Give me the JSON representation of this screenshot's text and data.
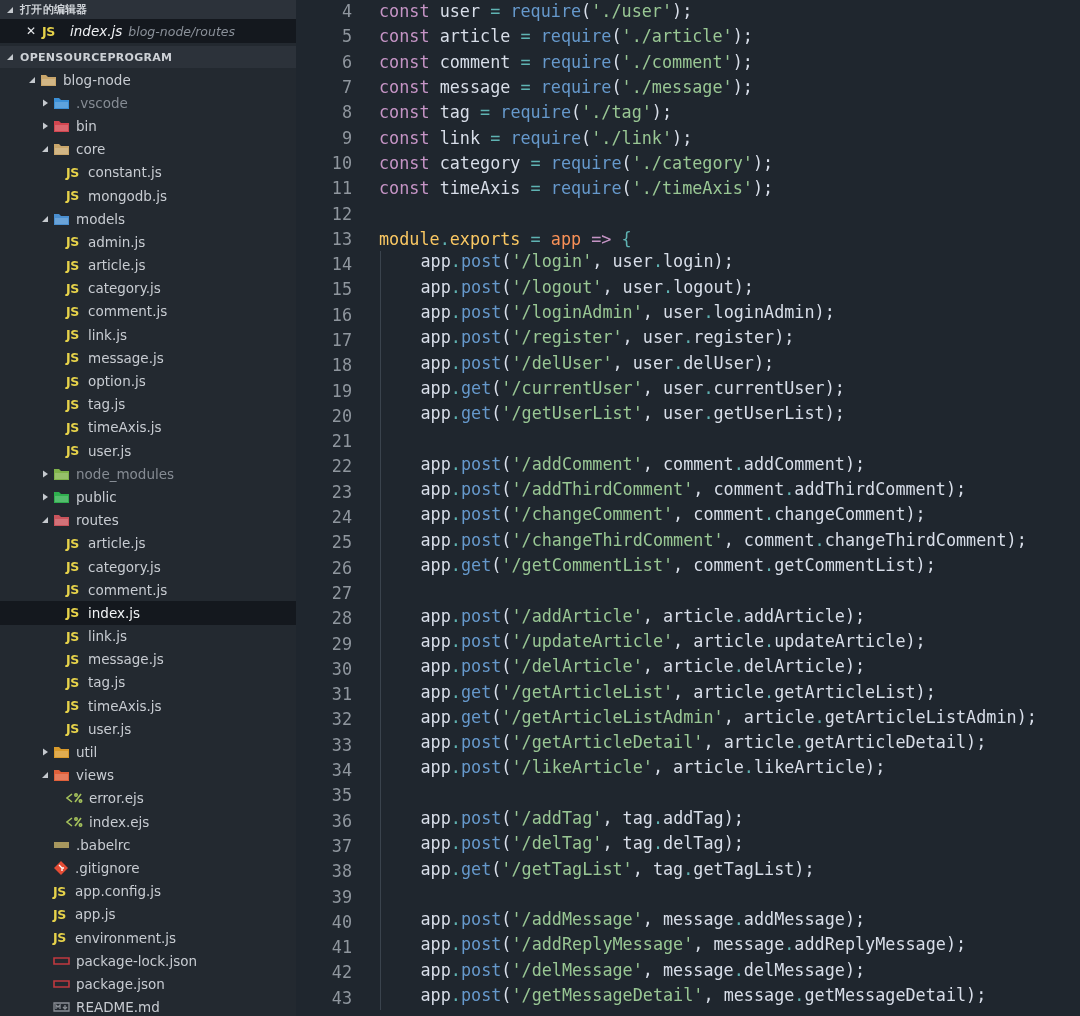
{
  "open_editors": {
    "title": "打开的编辑器",
    "expanded": true,
    "items": [
      {
        "close": "✕",
        "kind": "js",
        "icon": "JS",
        "name": "index.js",
        "path": "blog-node/routes",
        "selected": true
      }
    ]
  },
  "explorer": {
    "title": "OPENSOURCEPROGRAM",
    "expanded": true,
    "tree": [
      {
        "name": "blog-node",
        "kind": "folder",
        "color": "#c9a66b",
        "expanded": true,
        "selected": false,
        "ignored": false,
        "children": [
          {
            "name": ".vscode",
            "kind": "folder",
            "color": "#3b8fd6",
            "expanded": false,
            "selected": false,
            "ignored": true
          },
          {
            "name": "bin",
            "kind": "folder",
            "color": "#d2454f",
            "expanded": false,
            "selected": false,
            "ignored": false
          },
          {
            "name": "core",
            "kind": "folder",
            "color": "#c9a66b",
            "expanded": true,
            "selected": false,
            "ignored": false,
            "children": [
              {
                "name": "constant.js",
                "kind": "js",
                "icon": "JS",
                "selected": false,
                "ignored": false
              },
              {
                "name": "mongodb.js",
                "kind": "js",
                "icon": "JS",
                "selected": false,
                "ignored": false
              }
            ]
          },
          {
            "name": "models",
            "kind": "folder",
            "color": "#4a8fd0",
            "expanded": true,
            "selected": false,
            "ignored": false,
            "children": [
              {
                "name": "admin.js",
                "kind": "js",
                "icon": "JS",
                "selected": false,
                "ignored": false
              },
              {
                "name": "article.js",
                "kind": "js",
                "icon": "JS",
                "selected": false,
                "ignored": false
              },
              {
                "name": "category.js",
                "kind": "js",
                "icon": "JS",
                "selected": false,
                "ignored": false
              },
              {
                "name": "comment.js",
                "kind": "js",
                "icon": "JS",
                "selected": false,
                "ignored": false
              },
              {
                "name": "link.js",
                "kind": "js",
                "icon": "JS",
                "selected": false,
                "ignored": false
              },
              {
                "name": "message.js",
                "kind": "js",
                "icon": "JS",
                "selected": false,
                "ignored": false
              },
              {
                "name": "option.js",
                "kind": "js",
                "icon": "JS",
                "selected": false,
                "ignored": false
              },
              {
                "name": "tag.js",
                "kind": "js",
                "icon": "JS",
                "selected": false,
                "ignored": false
              },
              {
                "name": "timeAxis.js",
                "kind": "js",
                "icon": "JS",
                "selected": false,
                "ignored": false
              },
              {
                "name": "user.js",
                "kind": "js",
                "icon": "JS",
                "selected": false,
                "ignored": false
              }
            ]
          },
          {
            "name": "node_modules",
            "kind": "folder",
            "color": "#7fb24a",
            "expanded": false,
            "selected": false,
            "ignored": true
          },
          {
            "name": "public",
            "kind": "folder",
            "color": "#2fae4e",
            "expanded": false,
            "selected": false,
            "ignored": false
          },
          {
            "name": "routes",
            "kind": "folder",
            "color": "#c9545c",
            "expanded": true,
            "selected": false,
            "ignored": false,
            "children": [
              {
                "name": "article.js",
                "kind": "js",
                "icon": "JS",
                "selected": false,
                "ignored": false
              },
              {
                "name": "category.js",
                "kind": "js",
                "icon": "JS",
                "selected": false,
                "ignored": false
              },
              {
                "name": "comment.js",
                "kind": "js",
                "icon": "JS",
                "selected": false,
                "ignored": false
              },
              {
                "name": "index.js",
                "kind": "js",
                "icon": "JS",
                "selected": true,
                "ignored": false
              },
              {
                "name": "link.js",
                "kind": "js",
                "icon": "JS",
                "selected": false,
                "ignored": false
              },
              {
                "name": "message.js",
                "kind": "js",
                "icon": "JS",
                "selected": false,
                "ignored": false
              },
              {
                "name": "tag.js",
                "kind": "js",
                "icon": "JS",
                "selected": false,
                "ignored": false
              },
              {
                "name": "timeAxis.js",
                "kind": "js",
                "icon": "JS",
                "selected": false,
                "ignored": false
              },
              {
                "name": "user.js",
                "kind": "js",
                "icon": "JS",
                "selected": false,
                "ignored": false
              }
            ]
          },
          {
            "name": "util",
            "kind": "folder",
            "color": "#d99a2b",
            "expanded": false,
            "selected": false,
            "ignored": false
          },
          {
            "name": "views",
            "kind": "folder",
            "color": "#e0603a",
            "expanded": true,
            "selected": false,
            "ignored": false,
            "children": [
              {
                "name": "error.ejs",
                "kind": "ejs",
                "selected": false,
                "ignored": false
              },
              {
                "name": "index.ejs",
                "kind": "ejs",
                "selected": false,
                "ignored": false
              }
            ]
          },
          {
            "name": ".babelrc",
            "kind": "babel",
            "selected": false,
            "ignored": false
          },
          {
            "name": ".gitignore",
            "kind": "git",
            "selected": false,
            "ignored": false
          },
          {
            "name": "app.config.js",
            "kind": "js",
            "icon": "JS",
            "selected": false,
            "ignored": false
          },
          {
            "name": "app.js",
            "kind": "js",
            "icon": "JS",
            "selected": false,
            "ignored": false
          },
          {
            "name": "environment.js",
            "kind": "js",
            "icon": "JS",
            "selected": false,
            "ignored": false
          },
          {
            "name": "package-lock.json",
            "kind": "json",
            "selected": false,
            "ignored": false
          },
          {
            "name": "package.json",
            "kind": "json",
            "selected": false,
            "ignored": false
          },
          {
            "name": "README.md",
            "kind": "markdown",
            "selected": false,
            "ignored": false
          }
        ]
      }
    ]
  },
  "editor": {
    "lines": [
      {
        "number": "4",
        "indented": false,
        "tokens": [
          {
            "text": "const",
            "kind": "keyword"
          },
          {
            "text": " user ",
            "kind": "plain"
          },
          {
            "text": "= ",
            "kind": "operator"
          },
          {
            "text": "require",
            "kind": "function"
          },
          {
            "text": "(",
            "kind": "plain"
          },
          {
            "text": "'./user'",
            "kind": "string"
          },
          {
            "text": ");",
            "kind": "plain"
          }
        ]
      },
      {
        "number": "5",
        "indented": false,
        "tokens": [
          {
            "text": "const",
            "kind": "keyword"
          },
          {
            "text": " article ",
            "kind": "plain"
          },
          {
            "text": "= ",
            "kind": "operator"
          },
          {
            "text": "require",
            "kind": "function"
          },
          {
            "text": "(",
            "kind": "plain"
          },
          {
            "text": "'./article'",
            "kind": "string"
          },
          {
            "text": ");",
            "kind": "plain"
          }
        ]
      },
      {
        "number": "6",
        "indented": false,
        "tokens": [
          {
            "text": "const",
            "kind": "keyword"
          },
          {
            "text": " comment ",
            "kind": "plain"
          },
          {
            "text": "= ",
            "kind": "operator"
          },
          {
            "text": "require",
            "kind": "function"
          },
          {
            "text": "(",
            "kind": "plain"
          },
          {
            "text": "'./comment'",
            "kind": "string"
          },
          {
            "text": ");",
            "kind": "plain"
          }
        ]
      },
      {
        "number": "7",
        "indented": false,
        "tokens": [
          {
            "text": "const",
            "kind": "keyword"
          },
          {
            "text": " message ",
            "kind": "plain"
          },
          {
            "text": "= ",
            "kind": "operator"
          },
          {
            "text": "require",
            "kind": "function"
          },
          {
            "text": "(",
            "kind": "plain"
          },
          {
            "text": "'./message'",
            "kind": "string"
          },
          {
            "text": ");",
            "kind": "plain"
          }
        ]
      },
      {
        "number": "8",
        "indented": false,
        "tokens": [
          {
            "text": "const",
            "kind": "keyword"
          },
          {
            "text": " tag ",
            "kind": "plain"
          },
          {
            "text": "= ",
            "kind": "operator"
          },
          {
            "text": "require",
            "kind": "function"
          },
          {
            "text": "(",
            "kind": "plain"
          },
          {
            "text": "'./tag'",
            "kind": "string"
          },
          {
            "text": ");",
            "kind": "plain"
          }
        ]
      },
      {
        "number": "9",
        "indented": false,
        "tokens": [
          {
            "text": "const",
            "kind": "keyword"
          },
          {
            "text": " link ",
            "kind": "plain"
          },
          {
            "text": "= ",
            "kind": "operator"
          },
          {
            "text": "require",
            "kind": "function"
          },
          {
            "text": "(",
            "kind": "plain"
          },
          {
            "text": "'./link'",
            "kind": "string"
          },
          {
            "text": ");",
            "kind": "plain"
          }
        ]
      },
      {
        "number": "10",
        "indented": false,
        "tokens": [
          {
            "text": "const",
            "kind": "keyword"
          },
          {
            "text": " category ",
            "kind": "plain"
          },
          {
            "text": "= ",
            "kind": "operator"
          },
          {
            "text": "require",
            "kind": "function"
          },
          {
            "text": "(",
            "kind": "plain"
          },
          {
            "text": "'./category'",
            "kind": "string"
          },
          {
            "text": ");",
            "kind": "plain"
          }
        ]
      },
      {
        "number": "11",
        "indented": false,
        "tokens": [
          {
            "text": "const",
            "kind": "keyword"
          },
          {
            "text": " timeAxis ",
            "kind": "plain"
          },
          {
            "text": "= ",
            "kind": "operator"
          },
          {
            "text": "require",
            "kind": "function"
          },
          {
            "text": "(",
            "kind": "plain"
          },
          {
            "text": "'./timeAxis'",
            "kind": "string"
          },
          {
            "text": ");",
            "kind": "plain"
          }
        ]
      },
      {
        "number": "12",
        "indented": false
      },
      {
        "number": "13",
        "indented": false,
        "tokens": [
          {
            "text": "module",
            "kind": "property"
          },
          {
            "text": ".",
            "kind": "operator"
          },
          {
            "text": "exports",
            "kind": "property"
          },
          {
            "text": " = ",
            "kind": "operator"
          },
          {
            "text": "app",
            "kind": "parameter"
          },
          {
            "text": " => ",
            "kind": "keyword"
          },
          {
            "text": "{",
            "kind": "operator"
          }
        ]
      },
      {
        "number": "14",
        "indented": true,
        "tokens": [
          {
            "text": "app",
            "kind": "plain"
          },
          {
            "text": ".",
            "kind": "operator"
          },
          {
            "text": "post",
            "kind": "function"
          },
          {
            "text": "(",
            "kind": "plain"
          },
          {
            "text": "'/login'",
            "kind": "string"
          },
          {
            "text": ", user",
            "kind": "plain"
          },
          {
            "text": ".",
            "kind": "operator"
          },
          {
            "text": "login);",
            "kind": "plain"
          }
        ]
      },
      {
        "number": "15",
        "indented": true,
        "tokens": [
          {
            "text": "app",
            "kind": "plain"
          },
          {
            "text": ".",
            "kind": "operator"
          },
          {
            "text": "post",
            "kind": "function"
          },
          {
            "text": "(",
            "kind": "plain"
          },
          {
            "text": "'/logout'",
            "kind": "string"
          },
          {
            "text": ", user",
            "kind": "plain"
          },
          {
            "text": ".",
            "kind": "operator"
          },
          {
            "text": "logout);",
            "kind": "plain"
          }
        ]
      },
      {
        "number": "16",
        "indented": true,
        "tokens": [
          {
            "text": "app",
            "kind": "plain"
          },
          {
            "text": ".",
            "kind": "operator"
          },
          {
            "text": "post",
            "kind": "function"
          },
          {
            "text": "(",
            "kind": "plain"
          },
          {
            "text": "'/loginAdmin'",
            "kind": "string"
          },
          {
            "text": ", user",
            "kind": "plain"
          },
          {
            "text": ".",
            "kind": "operator"
          },
          {
            "text": "loginAdmin);",
            "kind": "plain"
          }
        ]
      },
      {
        "number": "17",
        "indented": true,
        "tokens": [
          {
            "text": "app",
            "kind": "plain"
          },
          {
            "text": ".",
            "kind": "operator"
          },
          {
            "text": "post",
            "kind": "function"
          },
          {
            "text": "(",
            "kind": "plain"
          },
          {
            "text": "'/register'",
            "kind": "string"
          },
          {
            "text": ", user",
            "kind": "plain"
          },
          {
            "text": ".",
            "kind": "operator"
          },
          {
            "text": "register);",
            "kind": "plain"
          }
        ]
      },
      {
        "number": "18",
        "indented": true,
        "tokens": [
          {
            "text": "app",
            "kind": "plain"
          },
          {
            "text": ".",
            "kind": "operator"
          },
          {
            "text": "post",
            "kind": "function"
          },
          {
            "text": "(",
            "kind": "plain"
          },
          {
            "text": "'/delUser'",
            "kind": "string"
          },
          {
            "text": ", user",
            "kind": "plain"
          },
          {
            "text": ".",
            "kind": "operator"
          },
          {
            "text": "delUser);",
            "kind": "plain"
          }
        ]
      },
      {
        "number": "19",
        "indented": true,
        "tokens": [
          {
            "text": "app",
            "kind": "plain"
          },
          {
            "text": ".",
            "kind": "operator"
          },
          {
            "text": "get",
            "kind": "function"
          },
          {
            "text": "(",
            "kind": "plain"
          },
          {
            "text": "'/currentUser'",
            "kind": "string"
          },
          {
            "text": ", user",
            "kind": "plain"
          },
          {
            "text": ".",
            "kind": "operator"
          },
          {
            "text": "currentUser);",
            "kind": "plain"
          }
        ]
      },
      {
        "number": "20",
        "indented": true,
        "tokens": [
          {
            "text": "app",
            "kind": "plain"
          },
          {
            "text": ".",
            "kind": "operator"
          },
          {
            "text": "get",
            "kind": "function"
          },
          {
            "text": "(",
            "kind": "plain"
          },
          {
            "text": "'/getUserList'",
            "kind": "string"
          },
          {
            "text": ", user",
            "kind": "plain"
          },
          {
            "text": ".",
            "kind": "operator"
          },
          {
            "text": "getUserList);",
            "kind": "plain"
          }
        ]
      },
      {
        "number": "21",
        "indented": true
      },
      {
        "number": "22",
        "indented": true,
        "tokens": [
          {
            "text": "app",
            "kind": "plain"
          },
          {
            "text": ".",
            "kind": "operator"
          },
          {
            "text": "post",
            "kind": "function"
          },
          {
            "text": "(",
            "kind": "plain"
          },
          {
            "text": "'/addComment'",
            "kind": "string"
          },
          {
            "text": ", comment",
            "kind": "plain"
          },
          {
            "text": ".",
            "kind": "operator"
          },
          {
            "text": "addComment);",
            "kind": "plain"
          }
        ]
      },
      {
        "number": "23",
        "indented": true,
        "tokens": [
          {
            "text": "app",
            "kind": "plain"
          },
          {
            "text": ".",
            "kind": "operator"
          },
          {
            "text": "post",
            "kind": "function"
          },
          {
            "text": "(",
            "kind": "plain"
          },
          {
            "text": "'/addThirdComment'",
            "kind": "string"
          },
          {
            "text": ", comment",
            "kind": "plain"
          },
          {
            "text": ".",
            "kind": "operator"
          },
          {
            "text": "addThirdComment);",
            "kind": "plain"
          }
        ]
      },
      {
        "number": "24",
        "indented": true,
        "tokens": [
          {
            "text": "app",
            "kind": "plain"
          },
          {
            "text": ".",
            "kind": "operator"
          },
          {
            "text": "post",
            "kind": "function"
          },
          {
            "text": "(",
            "kind": "plain"
          },
          {
            "text": "'/changeComment'",
            "kind": "string"
          },
          {
            "text": ", comment",
            "kind": "plain"
          },
          {
            "text": ".",
            "kind": "operator"
          },
          {
            "text": "changeComment);",
            "kind": "plain"
          }
        ]
      },
      {
        "number": "25",
        "indented": true,
        "tokens": [
          {
            "text": "app",
            "kind": "plain"
          },
          {
            "text": ".",
            "kind": "operator"
          },
          {
            "text": "post",
            "kind": "function"
          },
          {
            "text": "(",
            "kind": "plain"
          },
          {
            "text": "'/changeThirdComment'",
            "kind": "string"
          },
          {
            "text": ", comment",
            "kind": "plain"
          },
          {
            "text": ".",
            "kind": "operator"
          },
          {
            "text": "changeThirdComment);",
            "kind": "plain"
          }
        ]
      },
      {
        "number": "26",
        "indented": true,
        "tokens": [
          {
            "text": "app",
            "kind": "plain"
          },
          {
            "text": ".",
            "kind": "operator"
          },
          {
            "text": "get",
            "kind": "function"
          },
          {
            "text": "(",
            "kind": "plain"
          },
          {
            "text": "'/getCommentList'",
            "kind": "string"
          },
          {
            "text": ", comment",
            "kind": "plain"
          },
          {
            "text": ".",
            "kind": "operator"
          },
          {
            "text": "getCommentList);",
            "kind": "plain"
          }
        ]
      },
      {
        "number": "27",
        "indented": true
      },
      {
        "number": "28",
        "indented": true,
        "tokens": [
          {
            "text": "app",
            "kind": "plain"
          },
          {
            "text": ".",
            "kind": "operator"
          },
          {
            "text": "post",
            "kind": "function"
          },
          {
            "text": "(",
            "kind": "plain"
          },
          {
            "text": "'/addArticle'",
            "kind": "string"
          },
          {
            "text": ", article",
            "kind": "plain"
          },
          {
            "text": ".",
            "kind": "operator"
          },
          {
            "text": "addArticle);",
            "kind": "plain"
          }
        ]
      },
      {
        "number": "29",
        "indented": true,
        "tokens": [
          {
            "text": "app",
            "kind": "plain"
          },
          {
            "text": ".",
            "kind": "operator"
          },
          {
            "text": "post",
            "kind": "function"
          },
          {
            "text": "(",
            "kind": "plain"
          },
          {
            "text": "'/updateArticle'",
            "kind": "string"
          },
          {
            "text": ", article",
            "kind": "plain"
          },
          {
            "text": ".",
            "kind": "operator"
          },
          {
            "text": "updateArticle);",
            "kind": "plain"
          }
        ]
      },
      {
        "number": "30",
        "indented": true,
        "tokens": [
          {
            "text": "app",
            "kind": "plain"
          },
          {
            "text": ".",
            "kind": "operator"
          },
          {
            "text": "post",
            "kind": "function"
          },
          {
            "text": "(",
            "kind": "plain"
          },
          {
            "text": "'/delArticle'",
            "kind": "string"
          },
          {
            "text": ", article",
            "kind": "plain"
          },
          {
            "text": ".",
            "kind": "operator"
          },
          {
            "text": "delArticle);",
            "kind": "plain"
          }
        ]
      },
      {
        "number": "31",
        "indented": true,
        "tokens": [
          {
            "text": "app",
            "kind": "plain"
          },
          {
            "text": ".",
            "kind": "operator"
          },
          {
            "text": "get",
            "kind": "function"
          },
          {
            "text": "(",
            "kind": "plain"
          },
          {
            "text": "'/getArticleList'",
            "kind": "string"
          },
          {
            "text": ", article",
            "kind": "plain"
          },
          {
            "text": ".",
            "kind": "operator"
          },
          {
            "text": "getArticleList);",
            "kind": "plain"
          }
        ]
      },
      {
        "number": "32",
        "indented": true,
        "tokens": [
          {
            "text": "app",
            "kind": "plain"
          },
          {
            "text": ".",
            "kind": "operator"
          },
          {
            "text": "get",
            "kind": "function"
          },
          {
            "text": "(",
            "kind": "plain"
          },
          {
            "text": "'/getArticleListAdmin'",
            "kind": "string"
          },
          {
            "text": ", article",
            "kind": "plain"
          },
          {
            "text": ".",
            "kind": "operator"
          },
          {
            "text": "getArticleListAdmin);",
            "kind": "plain"
          }
        ]
      },
      {
        "number": "33",
        "indented": true,
        "tokens": [
          {
            "text": "app",
            "kind": "plain"
          },
          {
            "text": ".",
            "kind": "operator"
          },
          {
            "text": "post",
            "kind": "function"
          },
          {
            "text": "(",
            "kind": "plain"
          },
          {
            "text": "'/getArticleDetail'",
            "kind": "string"
          },
          {
            "text": ", article",
            "kind": "plain"
          },
          {
            "text": ".",
            "kind": "operator"
          },
          {
            "text": "getArticleDetail);",
            "kind": "plain"
          }
        ]
      },
      {
        "number": "34",
        "indented": true,
        "tokens": [
          {
            "text": "app",
            "kind": "plain"
          },
          {
            "text": ".",
            "kind": "operator"
          },
          {
            "text": "post",
            "kind": "function"
          },
          {
            "text": "(",
            "kind": "plain"
          },
          {
            "text": "'/likeArticle'",
            "kind": "string"
          },
          {
            "text": ", article",
            "kind": "plain"
          },
          {
            "text": ".",
            "kind": "operator"
          },
          {
            "text": "likeArticle);",
            "kind": "plain"
          }
        ]
      },
      {
        "number": "35",
        "indented": true
      },
      {
        "number": "36",
        "indented": true,
        "tokens": [
          {
            "text": "app",
            "kind": "plain"
          },
          {
            "text": ".",
            "kind": "operator"
          },
          {
            "text": "post",
            "kind": "function"
          },
          {
            "text": "(",
            "kind": "plain"
          },
          {
            "text": "'/addTag'",
            "kind": "string"
          },
          {
            "text": ", tag",
            "kind": "plain"
          },
          {
            "text": ".",
            "kind": "operator"
          },
          {
            "text": "addTag);",
            "kind": "plain"
          }
        ]
      },
      {
        "number": "37",
        "indented": true,
        "tokens": [
          {
            "text": "app",
            "kind": "plain"
          },
          {
            "text": ".",
            "kind": "operator"
          },
          {
            "text": "post",
            "kind": "function"
          },
          {
            "text": "(",
            "kind": "plain"
          },
          {
            "text": "'/delTag'",
            "kind": "string"
          },
          {
            "text": ", tag",
            "kind": "plain"
          },
          {
            "text": ".",
            "kind": "operator"
          },
          {
            "text": "delTag);",
            "kind": "plain"
          }
        ]
      },
      {
        "number": "38",
        "indented": true,
        "tokens": [
          {
            "text": "app",
            "kind": "plain"
          },
          {
            "text": ".",
            "kind": "operator"
          },
          {
            "text": "get",
            "kind": "function"
          },
          {
            "text": "(",
            "kind": "plain"
          },
          {
            "text": "'/getTagList'",
            "kind": "string"
          },
          {
            "text": ", tag",
            "kind": "plain"
          },
          {
            "text": ".",
            "kind": "operator"
          },
          {
            "text": "getTagList);",
            "kind": "plain"
          }
        ]
      },
      {
        "number": "39",
        "indented": true
      },
      {
        "number": "40",
        "indented": true,
        "tokens": [
          {
            "text": "app",
            "kind": "plain"
          },
          {
            "text": ".",
            "kind": "operator"
          },
          {
            "text": "post",
            "kind": "function"
          },
          {
            "text": "(",
            "kind": "plain"
          },
          {
            "text": "'/addMessage'",
            "kind": "string"
          },
          {
            "text": ", message",
            "kind": "plain"
          },
          {
            "text": ".",
            "kind": "operator"
          },
          {
            "text": "addMessage);",
            "kind": "plain"
          }
        ]
      },
      {
        "number": "41",
        "indented": true,
        "tokens": [
          {
            "text": "app",
            "kind": "plain"
          },
          {
            "text": ".",
            "kind": "operator"
          },
          {
            "text": "post",
            "kind": "function"
          },
          {
            "text": "(",
            "kind": "plain"
          },
          {
            "text": "'/addReplyMessage'",
            "kind": "string"
          },
          {
            "text": ", message",
            "kind": "plain"
          },
          {
            "text": ".",
            "kind": "operator"
          },
          {
            "text": "addReplyMessage);",
            "kind": "plain"
          }
        ]
      },
      {
        "number": "42",
        "indented": true,
        "tokens": [
          {
            "text": "app",
            "kind": "plain"
          },
          {
            "text": ".",
            "kind": "operator"
          },
          {
            "text": "post",
            "kind": "function"
          },
          {
            "text": "(",
            "kind": "plain"
          },
          {
            "text": "'/delMessage'",
            "kind": "string"
          },
          {
            "text": ", message",
            "kind": "plain"
          },
          {
            "text": ".",
            "kind": "operator"
          },
          {
            "text": "delMessage);",
            "kind": "plain"
          }
        ]
      },
      {
        "number": "43",
        "indented": true,
        "tokens": [
          {
            "text": "app",
            "kind": "plain"
          },
          {
            "text": ".",
            "kind": "operator"
          },
          {
            "text": "post",
            "kind": "function"
          },
          {
            "text": "(",
            "kind": "plain"
          },
          {
            "text": "'/getMessageDetail'",
            "kind": "string"
          },
          {
            "text": ", message",
            "kind": "plain"
          },
          {
            "text": ".",
            "kind": "operator"
          },
          {
            "text": "getMessageDetail);",
            "kind": "plain"
          }
        ]
      }
    ]
  }
}
